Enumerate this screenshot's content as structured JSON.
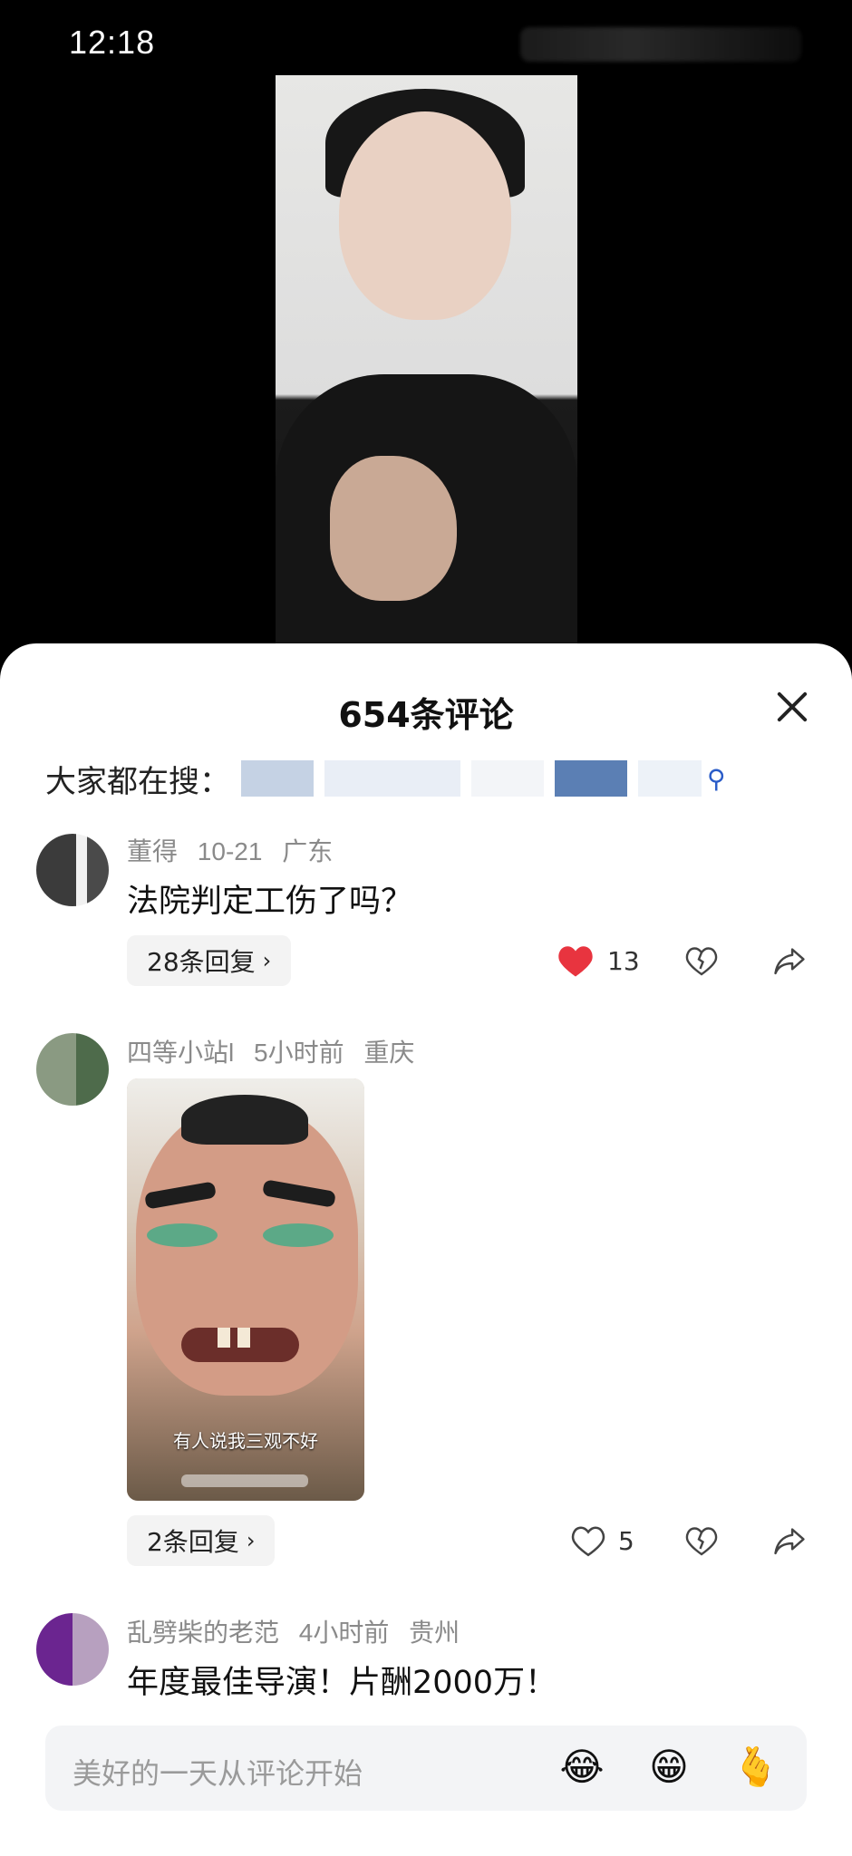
{
  "status": {
    "time": "12:18"
  },
  "comments_panel": {
    "title": "654条评论",
    "search_hint": "大家都在搜："
  },
  "comments": [
    {
      "user": "董得",
      "date": "10-21",
      "location": "广东",
      "text": "法院判定工伤了吗？",
      "replies_label": "28条回复",
      "likes": "13",
      "liked": true
    },
    {
      "user": "四等小站l",
      "date": "5小时前",
      "location": "重庆",
      "image_caption": "有人说我三观不好",
      "replies_label": "2条回复",
      "likes": "5",
      "liked": false
    },
    {
      "user": "乱劈柴的老范",
      "date": "4小时前",
      "location": "贵州",
      "text": "年度最佳导演！片酬2000万！"
    }
  ],
  "input": {
    "placeholder": "美好的一天从评论开始",
    "emojis": [
      "😂",
      "😁",
      "🫰"
    ]
  },
  "icons": [
    "close-icon",
    "search-icon",
    "heart-icon",
    "broken-heart-icon",
    "share-icon",
    "chevron-right-icon"
  ],
  "colors": {
    "like_red": "#e8343f",
    "sheet_bg": "#ffffff",
    "muted_text": "#8a8a8a"
  }
}
